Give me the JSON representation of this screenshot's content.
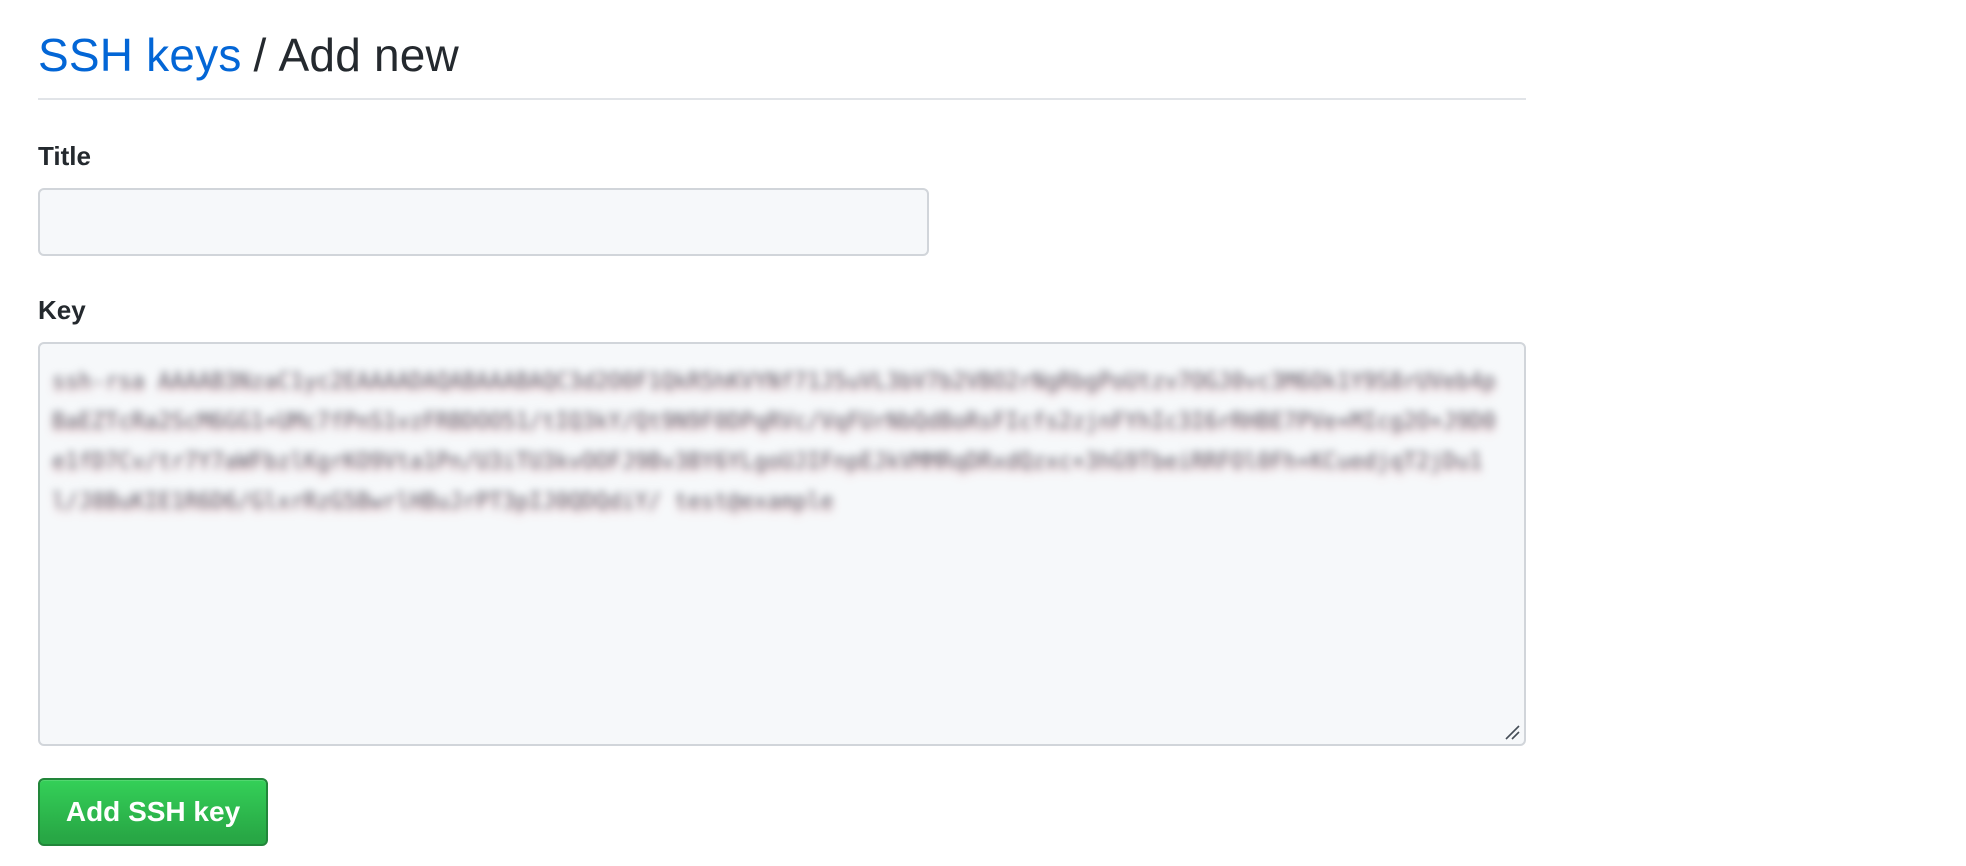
{
  "header": {
    "breadcrumb_link": "SSH keys",
    "separator": "/",
    "current": "Add new"
  },
  "form": {
    "title_label": "Title",
    "title_value": "",
    "key_label": "Key",
    "key_value": "ssh-rsa AAAAB3NzaC1yc2EAAAADAQABAAABAQC3d2O0F1QkR5hKVYNf71J5uVL3bV7b2VBO2rNgRbgPoUtzv7OGJ0vc3M6Ok1Y9S8rUVeb4pBaEZTcRa2ScM6GG1+UMc7fPnS1vzFRBDOO51/tIQ3kY/Qt9N9F0DPqRVc/VqFUrNbQdBoRsFIcfs2zjnFYhIc3I6rRHBE7PVe+MIcg2O+J9D0e1fD7Cv/tr7Y7aWFbzlKgrKO9Vta1Pn/U3iTU3kvOOFJ9Bv3BY6YLgoUJIFnpEJkVMMRqDRxdQzxc+3hG9TbeiRRFOl0Fh+KCuedjqT2jDu1l/J8BuKIE1R6D6/GlxrRzG5BwrlHBuJrPT3pIJ0QDQdiY/ test@example"
  },
  "actions": {
    "submit_label": "Add SSH key"
  }
}
